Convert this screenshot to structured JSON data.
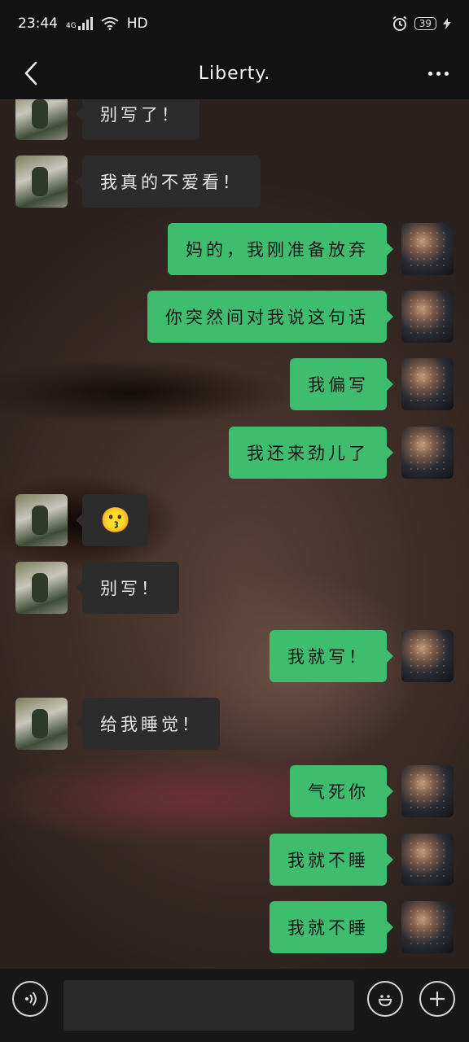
{
  "status_bar": {
    "time": "23:44",
    "network": "4G",
    "hd": "HD",
    "battery": "39"
  },
  "header": {
    "title": "Liberty."
  },
  "messages": [
    {
      "side": "left",
      "text": "别写了！"
    },
    {
      "side": "left",
      "text": "我真的不爱看！"
    },
    {
      "side": "right",
      "text": "妈的，我刚准备放弃"
    },
    {
      "side": "right",
      "text": "你突然间对我说这句话"
    },
    {
      "side": "right",
      "text": "我偏写"
    },
    {
      "side": "right",
      "text": "我还来劲儿了"
    },
    {
      "side": "left",
      "text": "😗"
    },
    {
      "side": "left",
      "text": "别写！"
    },
    {
      "side": "right",
      "text": "我就写！"
    },
    {
      "side": "left",
      "text": "给我睡觉！"
    },
    {
      "side": "right",
      "text": "气死你"
    },
    {
      "side": "right",
      "text": "我就不睡"
    },
    {
      "side": "right",
      "text": "我就不睡"
    }
  ],
  "input_bar": {
    "text_value": "",
    "voice_icon": "voice-icon",
    "emoji_icon": "emoji-icon",
    "plus_icon": "plus-icon"
  },
  "colors": {
    "bubble_sent": "#3ebd6f",
    "bubble_received": "#2c2c2c",
    "bar_background": "#121212"
  }
}
